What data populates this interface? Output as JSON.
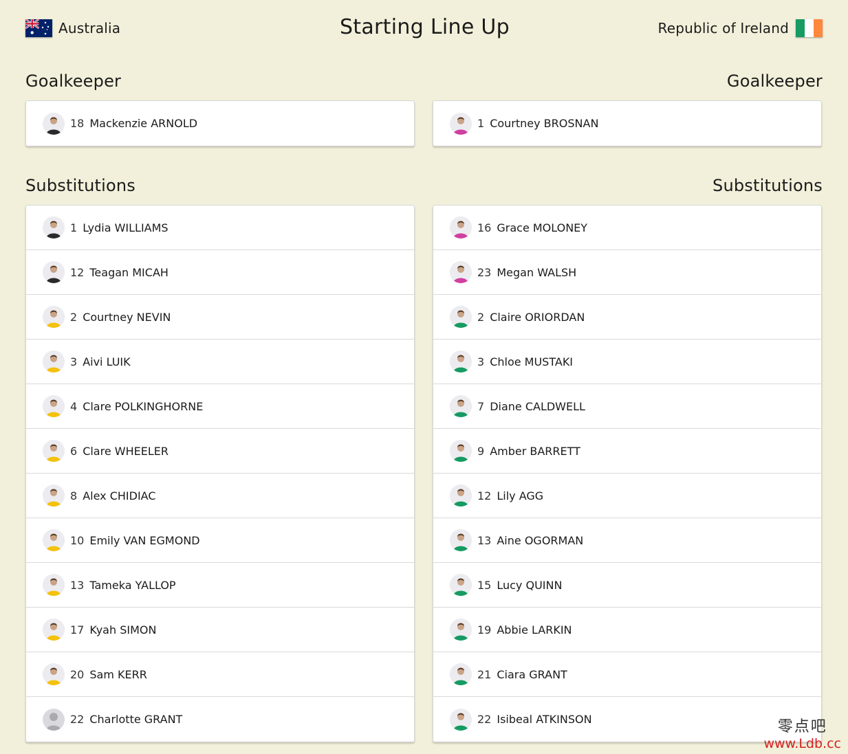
{
  "header": {
    "left_team": "Australia",
    "right_team": "Republic of Ireland",
    "title": "Starting Line Up"
  },
  "colors": {
    "background": "#f2f0da",
    "australia_kit": "#f4c20d",
    "australia_gk_kit": "#2a2a2a",
    "ireland_kit": "#169b62",
    "ireland_gk_kit": "#d13fa0"
  },
  "sections": {
    "goalkeeper_left": "Goalkeeper",
    "goalkeeper_right": "Goalkeeper",
    "subs_left": "Substitutions",
    "subs_right": "Substitutions"
  },
  "goalkeepers": {
    "left": [
      {
        "number": "18",
        "name": "Mackenzie ARNOLD",
        "kit": "gk-dark"
      }
    ],
    "right": [
      {
        "number": "1",
        "name": "Courtney BROSNAN",
        "kit": "gk-pink"
      }
    ]
  },
  "substitutions": {
    "left": [
      {
        "number": "1",
        "name": "Lydia WILLIAMS",
        "kit": "gk-dark"
      },
      {
        "number": "12",
        "name": "Teagan MICAH",
        "kit": "gk-dark"
      },
      {
        "number": "2",
        "name": "Courtney NEVIN",
        "kit": "yellow"
      },
      {
        "number": "3",
        "name": "Aivi LUIK",
        "kit": "yellow"
      },
      {
        "number": "4",
        "name": "Clare POLKINGHORNE",
        "kit": "yellow"
      },
      {
        "number": "6",
        "name": "Clare WHEELER",
        "kit": "yellow"
      },
      {
        "number": "8",
        "name": "Alex CHIDIAC",
        "kit": "yellow"
      },
      {
        "number": "10",
        "name": "Emily VAN EGMOND",
        "kit": "yellow"
      },
      {
        "number": "13",
        "name": "Tameka YALLOP",
        "kit": "yellow"
      },
      {
        "number": "17",
        "name": "Kyah SIMON",
        "kit": "yellow"
      },
      {
        "number": "20",
        "name": "Sam KERR",
        "kit": "yellow"
      },
      {
        "number": "22",
        "name": "Charlotte GRANT",
        "kit": "none"
      }
    ],
    "right": [
      {
        "number": "16",
        "name": "Grace MOLONEY",
        "kit": "gk-pink"
      },
      {
        "number": "23",
        "name": "Megan WALSH",
        "kit": "gk-pink"
      },
      {
        "number": "2",
        "name": "Claire ORIORDAN",
        "kit": "green"
      },
      {
        "number": "3",
        "name": "Chloe MUSTAKI",
        "kit": "green"
      },
      {
        "number": "7",
        "name": "Diane CALDWELL",
        "kit": "green"
      },
      {
        "number": "9",
        "name": "Amber BARRETT",
        "kit": "green"
      },
      {
        "number": "12",
        "name": "Lily AGG",
        "kit": "green"
      },
      {
        "number": "13",
        "name": "Aine OGORMAN",
        "kit": "green"
      },
      {
        "number": "15",
        "name": "Lucy QUINN",
        "kit": "green"
      },
      {
        "number": "19",
        "name": "Abbie LARKIN",
        "kit": "green"
      },
      {
        "number": "21",
        "name": "Ciara GRANT",
        "kit": "green"
      },
      {
        "number": "22",
        "name": "Isibeal ATKINSON",
        "kit": "green"
      }
    ]
  },
  "watermark": {
    "top": "零点吧",
    "bottom": "www.Ldb.cc"
  }
}
